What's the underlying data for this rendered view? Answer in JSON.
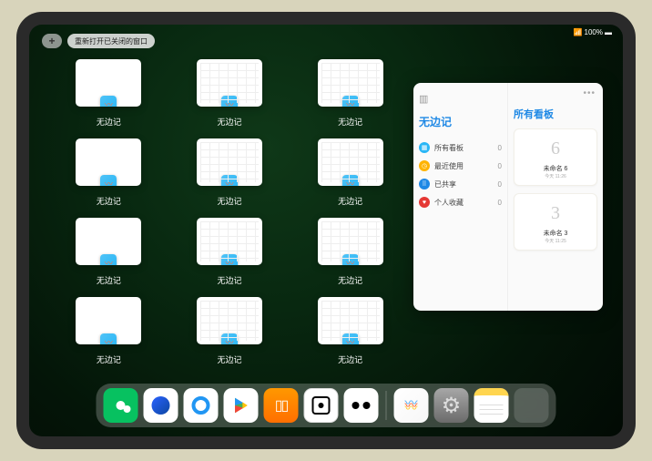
{
  "status": {
    "battery": "100%",
    "signal": "📶"
  },
  "topbar": {
    "plus_label": "+",
    "reopen_label": "重新打开已关闭的窗口"
  },
  "window_label": "无边记",
  "windows": [
    {
      "variant": "blank"
    },
    {
      "variant": "grid"
    },
    {
      "variant": "grid"
    },
    {
      "variant": "blank"
    },
    {
      "variant": "grid"
    },
    {
      "variant": "grid"
    },
    {
      "variant": "blank"
    },
    {
      "variant": "grid"
    },
    {
      "variant": "grid"
    },
    {
      "variant": "blank"
    },
    {
      "variant": "grid"
    },
    {
      "variant": "grid"
    }
  ],
  "panel": {
    "left_title": "无边记",
    "right_title": "所有看板",
    "items": [
      {
        "icon": "grid-icon",
        "color": "#29b6f6",
        "glyph": "▦",
        "label": "所有看板",
        "count": 0
      },
      {
        "icon": "clock-icon",
        "color": "#ffb300",
        "glyph": "◷",
        "label": "最近使用",
        "count": 0
      },
      {
        "icon": "shared-icon",
        "color": "#1e88e5",
        "glyph": "⠿",
        "label": "已共享",
        "count": 0
      },
      {
        "icon": "heart-icon",
        "color": "#e53935",
        "glyph": "♥",
        "label": "个人收藏",
        "count": 0
      }
    ],
    "cards": [
      {
        "sketch": "6",
        "label": "未命名 6",
        "sub": "今天 11:26"
      },
      {
        "sketch": "3",
        "label": "未命名 3",
        "sub": "今天 11:25"
      }
    ]
  },
  "dock": {
    "apps": [
      {
        "name": "wechat",
        "cls": "d-wechat"
      },
      {
        "name": "browser-hd",
        "cls": "d-qblue"
      },
      {
        "name": "quark",
        "cls": "d-quark"
      },
      {
        "name": "play-store",
        "cls": "d-play"
      },
      {
        "name": "books",
        "cls": "d-books"
      },
      {
        "name": "dice-app",
        "cls": "d-dot"
      },
      {
        "name": "two-dots",
        "cls": "d-two"
      }
    ],
    "recent": [
      {
        "name": "freeform",
        "cls": "d-free"
      },
      {
        "name": "settings",
        "cls": "d-settings"
      },
      {
        "name": "notes",
        "cls": "d-notes"
      },
      {
        "name": "app-library",
        "cls": "d-multi"
      }
    ]
  }
}
